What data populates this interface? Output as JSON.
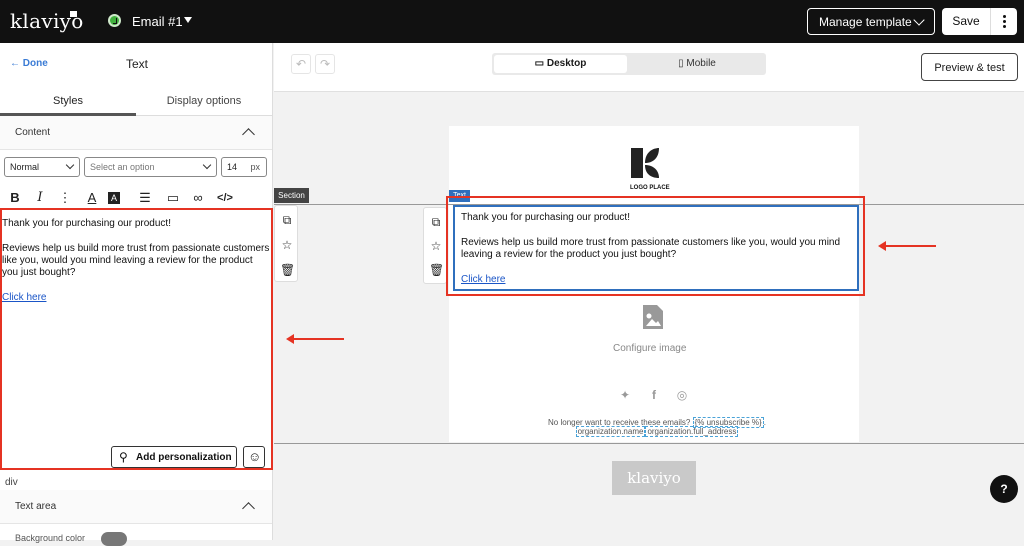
{
  "topbar": {
    "brand": "klaviyo",
    "email_name": "Email #1",
    "manage_label": "Manage template",
    "save_label": "Save"
  },
  "panel": {
    "done_label": "Done",
    "title": "Text",
    "tabs": [
      "Styles",
      "Display options"
    ],
    "content_label": "Content",
    "style_select": "Normal",
    "font_select_placeholder": "Select an option",
    "font_size": "14",
    "font_unit": "px",
    "editor_line1": "Thank you for purchasing our product!",
    "editor_line2": "Reviews help us build more trust from passionate customers like you, would you mind leaving a review for the product you just bought?",
    "editor_link": "Click here",
    "add_personalization": "Add personalization",
    "element_path": "div",
    "text_area_label": "Text area",
    "background_color_label": "Background color"
  },
  "canvas": {
    "view_desktop": "Desktop",
    "view_mobile": "Mobile",
    "preview_label": "Preview & test",
    "section_tag": "Section",
    "text_tag": "Text",
    "logo_text": "LOGO PLACE",
    "block_line1": "Thank you for purchasing our product!",
    "block_line2": "Reviews help us build more trust from passionate customers like you, would you mind leaving a review for the product you just bought?",
    "block_link": "Click here",
    "configure_image": "Configure image",
    "unsubscribe_text": "No longer want to receive these emails? ",
    "unsubscribe_tag": "{% unsubscribe %}",
    "unsubscribe_period": ".",
    "org_name": "organization.name",
    "org_address": "organization.full_address",
    "footer_brand": "klaviyo"
  },
  "help_label": "?",
  "colors": {
    "accent_red": "#e53323",
    "selection_blue": "#2f6fbd",
    "link_blue": "#1a55c7",
    "status_green": "#41b13e"
  }
}
